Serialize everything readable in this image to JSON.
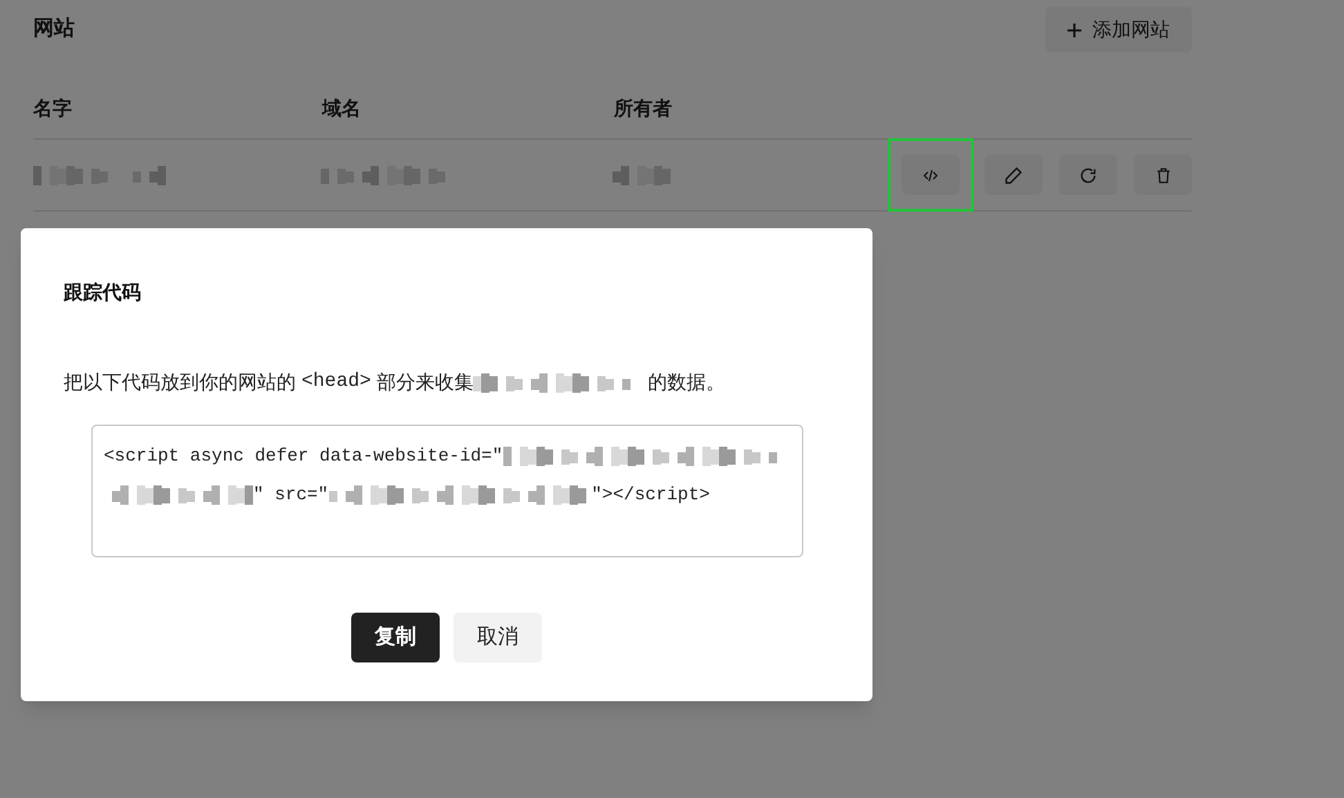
{
  "page": {
    "title": "网站",
    "add_button": "添加网站"
  },
  "table": {
    "columns": [
      "名字",
      "域名",
      "所有者"
    ],
    "rows": [
      {
        "cells": [
          {
            "kind": "redacted"
          },
          {
            "kind": "redacted"
          },
          {
            "kind": "redacted"
          }
        ],
        "actions": [
          {
            "kind": "code",
            "highlighted": true
          },
          {
            "kind": "edit",
            "highlighted": false
          },
          {
            "kind": "reset",
            "highlighted": false
          },
          {
            "kind": "delete",
            "highlighted": false
          }
        ]
      }
    ]
  },
  "dialog": {
    "title": "跟踪代码",
    "message": [
      {
        "kind": "text",
        "text": "把以下代码放到你的网站的"
      },
      {
        "kind": "code",
        "text": "<head>"
      },
      {
        "kind": "text",
        "text": "部分来收集"
      },
      {
        "kind": "redacted"
      },
      {
        "kind": "text",
        "text": "的数据。"
      }
    ],
    "code_lines": [
      [
        {
          "kind": "text",
          "text": "<script async defer data-website-id=\""
        },
        {
          "kind": "redacted"
        }
      ],
      [
        {
          "kind": "redacted"
        },
        {
          "kind": "text",
          "text": "\" src=\""
        },
        {
          "kind": "redacted"
        },
        {
          "kind": "text",
          "text": "\"></script>"
        }
      ]
    ],
    "buttons": [
      {
        "label": "复制",
        "primary": true
      },
      {
        "label": "取消",
        "primary": false
      }
    ]
  }
}
